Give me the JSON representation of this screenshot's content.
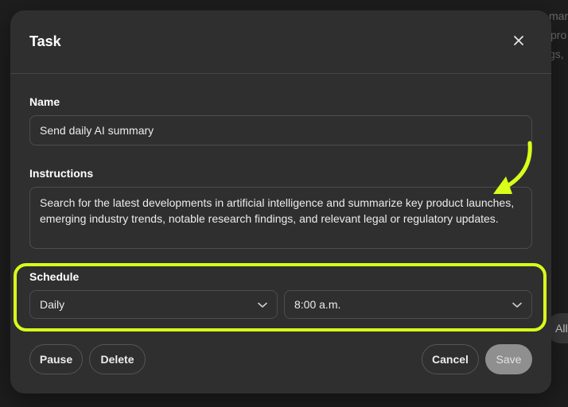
{
  "background": {
    "fragments": [
      "mary",
      "pro",
      "gs,"
    ],
    "pill_label": "All"
  },
  "modal": {
    "title": "Task",
    "close_icon": "close-icon",
    "name": {
      "label": "Name",
      "value": "Send daily AI summary"
    },
    "instructions": {
      "label": "Instructions",
      "value": "Search for the latest developments in artificial intelligence and summarize key product launches, emerging industry trends, notable research findings, and relevant legal or regulatory updates."
    },
    "schedule": {
      "label": "Schedule",
      "frequency": "Daily",
      "time": "8:00 a.m.",
      "dropdown_icon": "chevron-down-icon"
    },
    "buttons": {
      "pause": "Pause",
      "delete": "Delete",
      "cancel": "Cancel",
      "save": "Save"
    }
  },
  "annotation": {
    "highlight_color": "#d9ff1a",
    "arrow_icon": "annotation-arrow-icon"
  },
  "colors": {
    "modal_bg": "#2f2f2f",
    "page_bg": "#1e1e1e",
    "border": "#4d4d4d",
    "save_disabled": "#8f8f8f"
  }
}
